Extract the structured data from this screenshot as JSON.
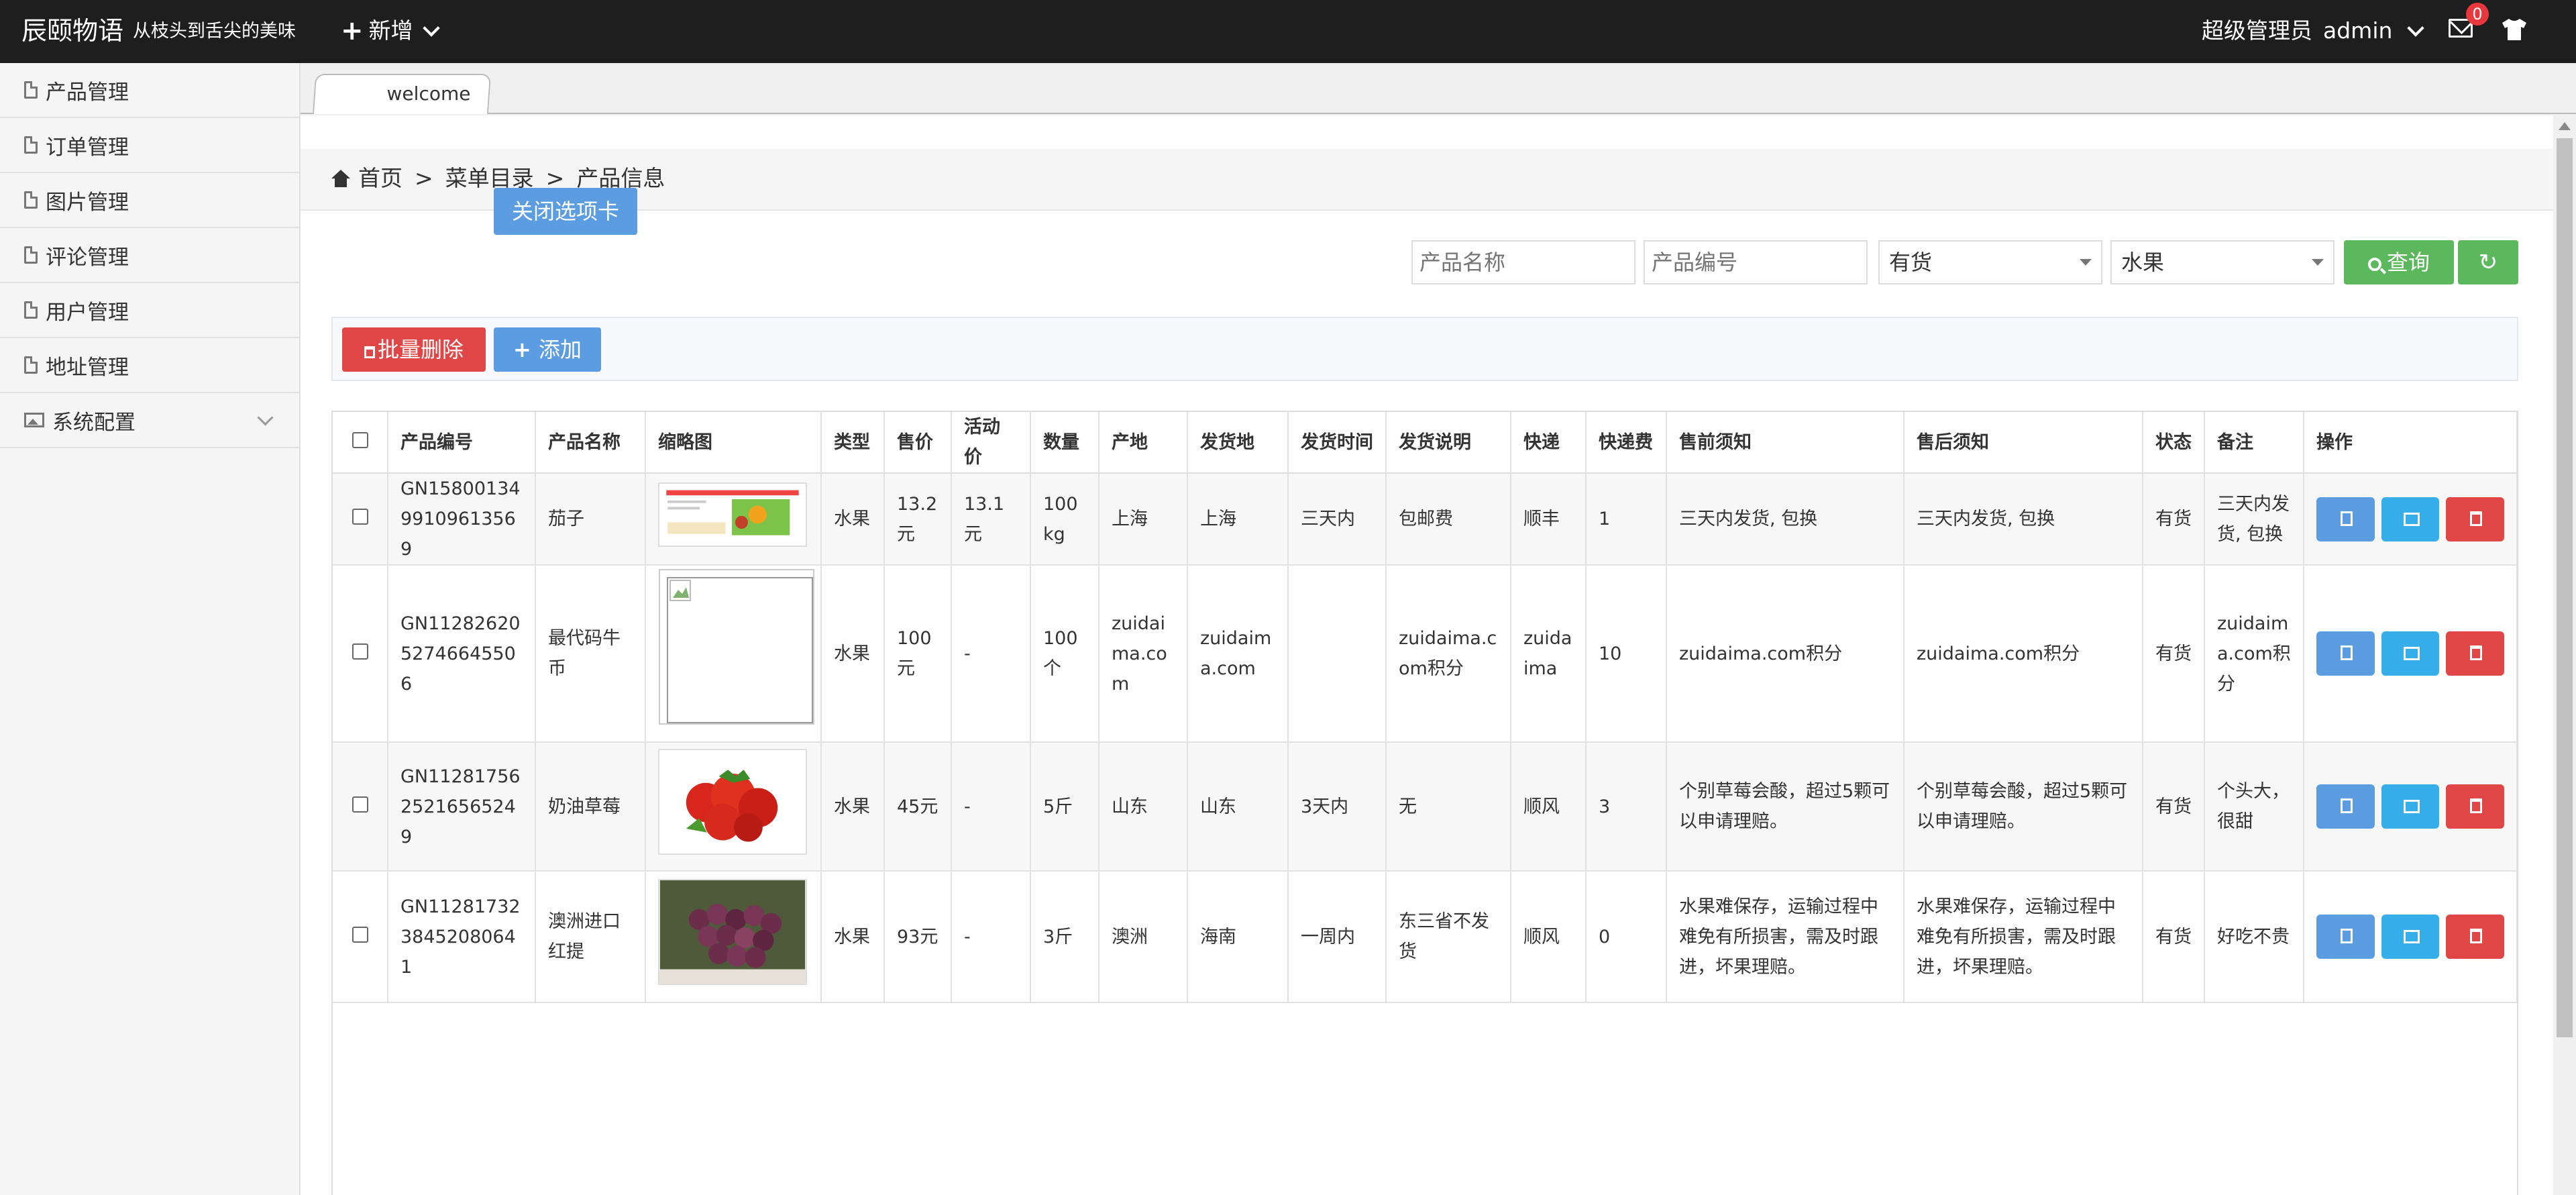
{
  "topbar": {
    "brand": "辰颐物语",
    "slogan": "从枝头到舌尖的美味",
    "add_label": "新增",
    "role": "超级管理员",
    "username": "admin",
    "mail_count": "0"
  },
  "sidebar": {
    "items": [
      {
        "label": "产品管理"
      },
      {
        "label": "订单管理"
      },
      {
        "label": "图片管理"
      },
      {
        "label": "评论管理"
      },
      {
        "label": "用户管理"
      },
      {
        "label": "地址管理"
      },
      {
        "label": "系统配置"
      }
    ]
  },
  "tabs": [
    {
      "label": "welcome"
    }
  ],
  "breadcrumb": {
    "home": "首页",
    "sep": ">",
    "level1": "菜单目录",
    "level2": "产品信息"
  },
  "close_tab_label": "关闭选项卡",
  "search": {
    "name_placeholder": "产品名称",
    "code_placeholder": "产品编号",
    "stock_value": "有货",
    "category_value": "水果",
    "query_label": "查询"
  },
  "actions": {
    "batch_delete": "批量删除",
    "add": "添加"
  },
  "table": {
    "headers": [
      "产品编号",
      "产品名称",
      "缩略图",
      "类型",
      "售价",
      "活动价",
      "数量",
      "产地",
      "发货地",
      "发货时间",
      "发货说明",
      "快递",
      "快递费",
      "售前须知",
      "售后须知",
      "状态",
      "备注",
      "操作"
    ],
    "rows": [
      {
        "code": "GN1580013499109613569",
        "name": "茄子",
        "type": "水果",
        "price": "13.2元",
        "promo": "13.1元",
        "qty": "100kg",
        "origin": "上海",
        "ship_from": "上海",
        "ship_time": "三天内",
        "ship_note": "包邮费",
        "express": "顺丰",
        "fee": "1",
        "pre": "三天内发货, 包换",
        "post": "三天内发货, 包换",
        "status": "有货",
        "remark": "三天内发货, 包换"
      },
      {
        "code": "GN1128262052746645506",
        "name": "最代码牛币",
        "type": "水果",
        "price": "100元",
        "promo": "-",
        "qty": "100个",
        "origin": "zuidaima.com",
        "ship_from": "zuidaima.com",
        "ship_time": "",
        "ship_note": "zuidaima.com积分",
        "express": "zuidaima",
        "fee": "10",
        "pre": "zuidaima.com积分",
        "post": "zuidaima.com积分",
        "status": "有货",
        "remark": "zuidaima.com积分"
      },
      {
        "code": "GN1128175625216565249",
        "name": "奶油草莓",
        "type": "水果",
        "price": "45元",
        "promo": "-",
        "qty": "5斤",
        "origin": "山东",
        "ship_from": "山东",
        "ship_time": "3天内",
        "ship_note": "无",
        "express": "顺风",
        "fee": "3",
        "pre": "个别草莓会酸，超过5颗可以申请理赔。",
        "post": "个别草莓会酸，超过5颗可以申请理赔。",
        "status": "有货",
        "remark": "个头大，很甜"
      },
      {
        "code": "GN1128173238452080641",
        "name": "澳洲进口红提",
        "type": "水果",
        "price": "93元",
        "promo": "-",
        "qty": "3斤",
        "origin": "澳洲",
        "ship_from": "海南",
        "ship_time": "一周内",
        "ship_note": "东三省不发货",
        "express": "顺风",
        "fee": "0",
        "pre": "水果难保存，运输过程中难免有所损害，需及时跟进，坏果理赔。",
        "post": "水果难保存，运输过程中难免有所损害，需及时跟进，坏果理赔。",
        "status": "有货",
        "remark": "好吃不贵"
      }
    ]
  },
  "colors": {
    "topbar": "#1e1e1e",
    "primary": "#5b9de0",
    "success": "#5cb85c",
    "danger": "#e04646",
    "info": "#36aeea",
    "badge": "#e8383d"
  },
  "icons": [
    "doc-icon",
    "image-icon",
    "chevron-down-icon",
    "home-icon",
    "search-icon",
    "refresh-icon",
    "edit-icon",
    "trash-icon",
    "mail-icon",
    "shirt-icon",
    "plus-icon"
  ]
}
